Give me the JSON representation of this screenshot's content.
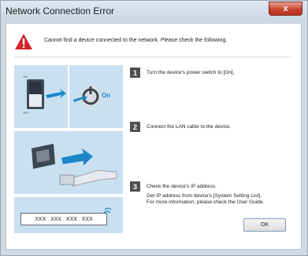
{
  "window": {
    "title": "Network Connection Error",
    "close_glyph": "x"
  },
  "message": {
    "text": "Cannot find a device connected to the network. Please check the following.",
    "icon": "warning-icon"
  },
  "steps": [
    {
      "number": "1",
      "text": "Turn the device's power switch to [On].",
      "illustration_label": "On"
    },
    {
      "number": "2",
      "text": "Connect the LAN cable to the device."
    },
    {
      "number": "3",
      "text": "Check the device's IP address.",
      "detail1": "Get IP address from device's [System Setting List].",
      "detail2": "For more information, please check the User Guide.",
      "ip_placeholder": "XXX . XXX . XXX . XXX"
    }
  ],
  "buttons": {
    "ok": "OK"
  },
  "colors": {
    "panel": "#c9e0f1",
    "warning": "#d0262b",
    "accent": "#1a86c8"
  }
}
